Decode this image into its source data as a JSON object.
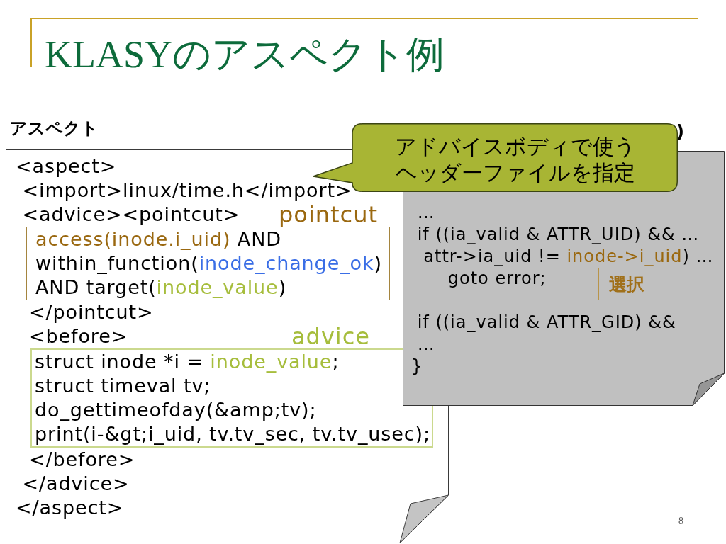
{
  "title": "KLASYのアスペクト例",
  "aspect": {
    "heading": "アスペクト",
    "items": [
      {
        "kind": "line",
        "segments": [
          {
            "kind": "plain",
            "text": "<aspect>"
          }
        ]
      },
      {
        "kind": "line",
        "segments": [
          {
            "kind": "plain",
            "text": " <import>linux/time.h</import>"
          }
        ]
      },
      {
        "kind": "line",
        "segments": [
          {
            "kind": "plain",
            "text": " <advice><pointcut>"
          }
        ],
        "label": {
          "kind": "pointcut",
          "text": "pointcut"
        }
      },
      {
        "kind": "pointcut",
        "lines": [
          [
            {
              "kind": "event",
              "text": "access(inode.i_uid)"
            },
            {
              "kind": "plain",
              "text": " AND"
            }
          ],
          [
            {
              "kind": "plain",
              "text": "within_function("
            },
            {
              "kind": "function",
              "text": "inode_change_ok"
            },
            {
              "kind": "plain",
              "text": ")"
            }
          ],
          [
            {
              "kind": "plain",
              "text": "AND target("
            },
            {
              "kind": "variable",
              "text": "inode_value"
            },
            {
              "kind": "plain",
              "text": ")"
            }
          ]
        ]
      },
      {
        "kind": "line",
        "segments": [
          {
            "kind": "plain",
            "text": "  </pointcut>"
          }
        ]
      },
      {
        "kind": "line",
        "segments": [
          {
            "kind": "plain",
            "text": "  <before>"
          }
        ],
        "label": {
          "kind": "advice",
          "text": "advice"
        }
      },
      {
        "kind": "advice",
        "lines": [
          [
            {
              "kind": "plain",
              "text": "struct inode *i = "
            },
            {
              "kind": "variable",
              "text": "inode_value"
            },
            {
              "kind": "plain",
              "text": ";"
            }
          ],
          [
            {
              "kind": "plain",
              "text": "struct timeval tv;"
            }
          ],
          [
            {
              "kind": "plain",
              "text": "do_gettimeofday(&amp;tv);"
            }
          ],
          [
            {
              "kind": "plain",
              "text": "print(i-&gt;i_uid, tv.tv_sec, tv.tv_usec);"
            }
          ]
        ]
      },
      {
        "kind": "line",
        "segments": [
          {
            "kind": "plain",
            "text": "  </before>"
          }
        ]
      },
      {
        "kind": "line",
        "segments": [
          {
            "kind": "plain",
            "text": " </advice>"
          }
        ]
      },
      {
        "kind": "line",
        "segments": [
          {
            "kind": "plain",
            "text": "</aspect>"
          }
        ]
      }
    ]
  },
  "kernel": {
    "heading": ")",
    "blocks": [
      [
        {
          "segments": [
            {
              "kind": "plain",
              "text": " …"
            }
          ]
        },
        {
          "segments": [
            {
              "kind": "plain",
              "text": " if ((ia_valid & ATTR_UID) && …"
            }
          ]
        },
        {
          "segments": [
            {
              "kind": "plain",
              "text": "  attr->ia_uid != "
            },
            {
              "kind": "event",
              "text": "inode->i_uid"
            },
            {
              "kind": "plain",
              "text": ") …"
            }
          ]
        },
        {
          "segments": [
            {
              "kind": "plain",
              "text": "      goto error;"
            }
          ],
          "badge": "選択"
        }
      ],
      [
        {
          "segments": [
            {
              "kind": "plain",
              "text": " if ((ia_valid & ATTR_GID) &&"
            }
          ]
        },
        {
          "segments": [
            {
              "kind": "plain",
              "text": " …"
            }
          ]
        },
        {
          "segments": [
            {
              "kind": "plain",
              "text": "}"
            }
          ]
        }
      ]
    ]
  },
  "callout": {
    "lines": [
      "アドバイスボディで使う",
      "ヘッダーファイルを指定"
    ]
  },
  "page_number": "8"
}
